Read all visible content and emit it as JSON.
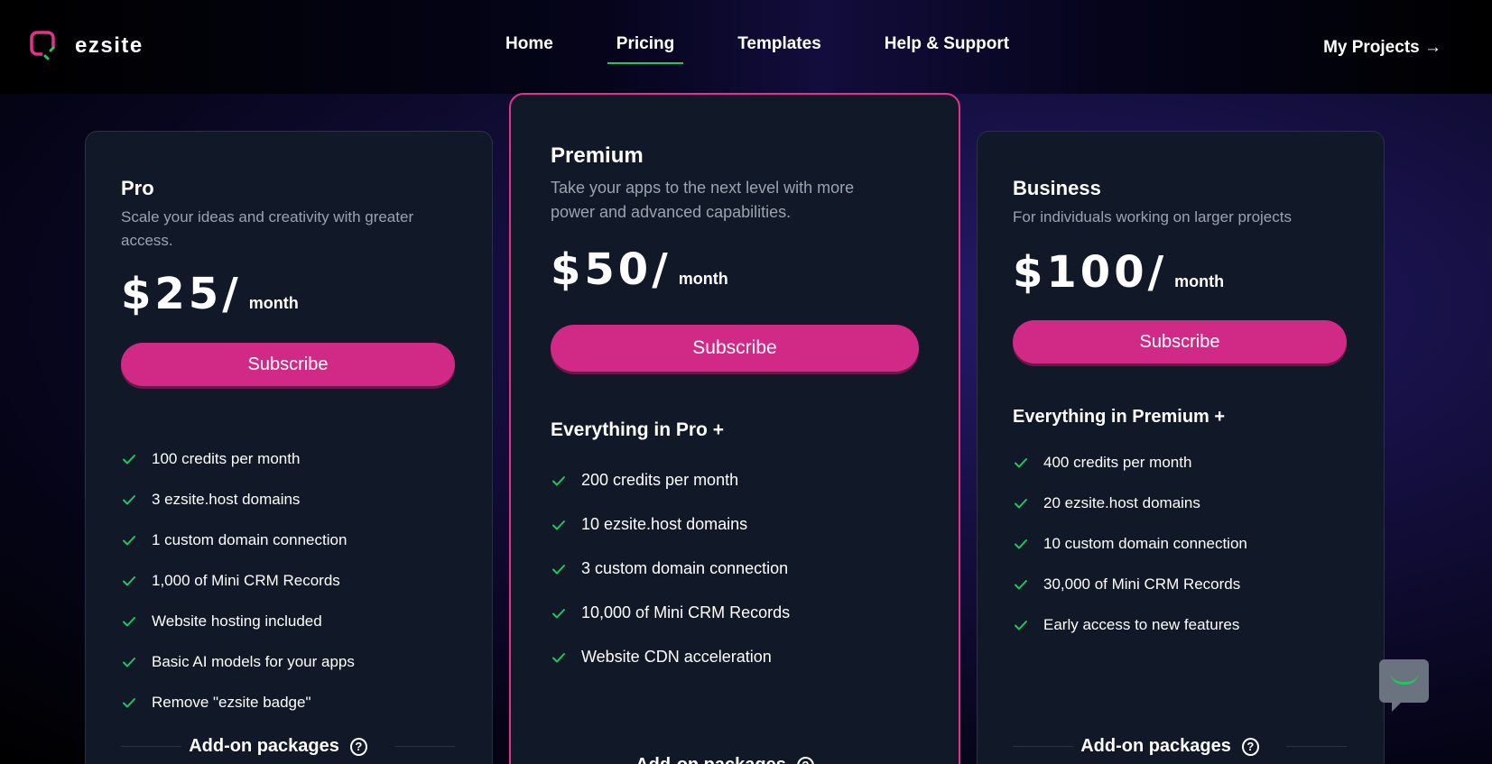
{
  "header": {
    "logo_text": "ezsite",
    "nav": [
      {
        "label": "Home"
      },
      {
        "label": "Pricing"
      },
      {
        "label": "Templates"
      },
      {
        "label": "Help & Support"
      }
    ],
    "my_projects": "My Projects →"
  },
  "plans": [
    {
      "name": "Pro",
      "description": "Scale your ideas and creativity with greater access.",
      "price": "$25/",
      "period": "month",
      "subscribe_label": "Subscribe",
      "section_title": "",
      "features": [
        "100 credits per month",
        "3 ezsite.host domains",
        "1 custom domain connection",
        "1,000 of Mini CRM Records",
        "Website hosting included",
        "Basic AI models for your apps",
        "Remove \"ezsite badge\""
      ],
      "addon_label": "Add-on packages"
    },
    {
      "name": "Premium",
      "description": "Take your apps to the next level with more power and advanced capabilities.",
      "price": "$50/",
      "period": "month",
      "subscribe_label": "Subscribe",
      "section_title": "Everything in Pro +",
      "features": [
        "200 credits per month",
        "10 ezsite.host domains",
        "3 custom domain connection",
        "10,000 of Mini CRM Records",
        "Website CDN acceleration"
      ],
      "addon_label": "Add-on packages"
    },
    {
      "name": "Business",
      "description": "For individuals working on larger projects",
      "price": "$100/",
      "period": "month",
      "subscribe_label": "Subscribe",
      "section_title": "Everything in Premium +",
      "features": [
        "400 credits per month",
        "20 ezsite.host domains",
        "10 custom domain connection",
        "30,000 of Mini CRM Records",
        "Early access to new features"
      ],
      "addon_label": "Add-on packages"
    }
  ],
  "colors": {
    "accent": "#d12a86",
    "check": "#22c55e",
    "card_bg": "#111827",
    "premium_border": "#e0338a"
  },
  "icons": {
    "feature_check": "check-icon",
    "addon_help": "help-circle-icon",
    "chat": "chat-bubble-icon"
  }
}
